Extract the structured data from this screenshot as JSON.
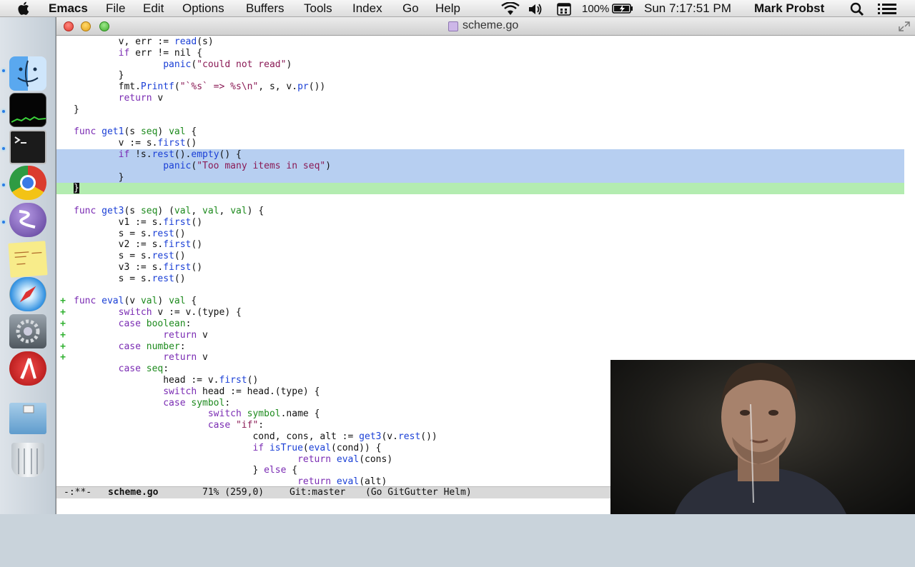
{
  "menubar": {
    "app_name": "Emacs",
    "menus": [
      "File",
      "Edit",
      "Options",
      "Buffers",
      "Tools",
      "Index",
      "Go",
      "Help"
    ],
    "battery": "100%",
    "clock": "Sun 7:17:51 PM",
    "user": "Mark Probst"
  },
  "window": {
    "title": "scheme.go"
  },
  "editor": {
    "lines": [
      {
        "gutter": "",
        "code": "        v, err := read(s)",
        "hl": ""
      },
      {
        "gutter": "",
        "code": "        if err != nil {",
        "hl": ""
      },
      {
        "gutter": "",
        "code": "                panic(\"could not read\")",
        "hl": ""
      },
      {
        "gutter": "",
        "code": "        }",
        "hl": ""
      },
      {
        "gutter": "",
        "code": "        fmt.Printf(\"`%s` => %s\\n\", s, v.pr())",
        "hl": ""
      },
      {
        "gutter": "",
        "code": "        return v",
        "hl": ""
      },
      {
        "gutter": "",
        "code": "}",
        "hl": ""
      },
      {
        "gutter": "",
        "code": "",
        "hl": ""
      },
      {
        "gutter": "",
        "code": "func get1(s seq) val {",
        "hl": ""
      },
      {
        "gutter": "",
        "code": "        v := s.first()",
        "hl": ""
      },
      {
        "gutter": "",
        "code": "        if !s.rest().empty() {",
        "hl": "sel"
      },
      {
        "gutter": "",
        "code": "                panic(\"Too many items in seq\")",
        "hl": "sel"
      },
      {
        "gutter": "",
        "code": "        }",
        "hl": "sel"
      },
      {
        "gutter": "",
        "code": "}",
        "hl": "cur"
      },
      {
        "gutter": "",
        "code": "",
        "hl": ""
      },
      {
        "gutter": "",
        "code": "func get3(s seq) (val, val, val) {",
        "hl": ""
      },
      {
        "gutter": "",
        "code": "        v1 := s.first()",
        "hl": ""
      },
      {
        "gutter": "",
        "code": "        s = s.rest()",
        "hl": ""
      },
      {
        "gutter": "",
        "code": "        v2 := s.first()",
        "hl": ""
      },
      {
        "gutter": "",
        "code": "        s = s.rest()",
        "hl": ""
      },
      {
        "gutter": "",
        "code": "        v3 := s.first()",
        "hl": ""
      },
      {
        "gutter": "",
        "code": "        s = s.rest()",
        "hl": ""
      },
      {
        "gutter": "",
        "code": "",
        "hl": ""
      },
      {
        "gutter": "+",
        "code": "func eval(v val) val {",
        "hl": ""
      },
      {
        "gutter": "+",
        "code": "        switch v := v.(type) {",
        "hl": ""
      },
      {
        "gutter": "+",
        "code": "        case boolean:",
        "hl": ""
      },
      {
        "gutter": "+",
        "code": "                return v",
        "hl": ""
      },
      {
        "gutter": "+",
        "code": "        case number:",
        "hl": ""
      },
      {
        "gutter": "+",
        "code": "                return v",
        "hl": ""
      },
      {
        "gutter": "",
        "code": "        case seq:",
        "hl": ""
      },
      {
        "gutter": "",
        "code": "                head := v.first()",
        "hl": ""
      },
      {
        "gutter": "",
        "code": "                switch head := head.(type) {",
        "hl": ""
      },
      {
        "gutter": "",
        "code": "                case symbol:",
        "hl": ""
      },
      {
        "gutter": "",
        "code": "                        switch symbol.name {",
        "hl": ""
      },
      {
        "gutter": "",
        "code": "                        case \"if\":",
        "hl": ""
      },
      {
        "gutter": "",
        "code": "                                cond, cons, alt := get3(v.rest())",
        "hl": ""
      },
      {
        "gutter": "",
        "code": "                                if isTrue(eval(cond)) {",
        "hl": ""
      },
      {
        "gutter": "",
        "code": "                                        return eval(cons)",
        "hl": ""
      },
      {
        "gutter": "",
        "code": "                                } else {",
        "hl": ""
      },
      {
        "gutter": "",
        "code": "                                        return eval(alt)",
        "hl": ""
      }
    ]
  },
  "modeline": {
    "status": "-:**-",
    "buffer": "scheme.go",
    "position": "71% (259,0)",
    "vc": "Git:master",
    "modes": "(Go GitGutter Helm)"
  },
  "colors": {
    "selection": "#b7cff1",
    "current_line": "#b3ecb0",
    "keyword": "#7a2bb3",
    "type": "#1d8a1d",
    "function": "#1a3fd6",
    "string": "#8a1a55",
    "gutter_added": "#2fb02f"
  },
  "icons": {
    "menubar": [
      "apple-icon",
      "wifi-icon",
      "volume-icon",
      "date-icon",
      "battery-icon",
      "spotlight-icon",
      "notification-center-icon"
    ],
    "dock": [
      "finder-icon",
      "activity-monitor-icon",
      "terminal-icon",
      "chrome-icon",
      "emacs-icon",
      "stickies-icon",
      "safari-icon",
      "system-preferences-icon",
      "lisp-icon",
      "downloads-folder-icon",
      "trash-icon"
    ]
  }
}
